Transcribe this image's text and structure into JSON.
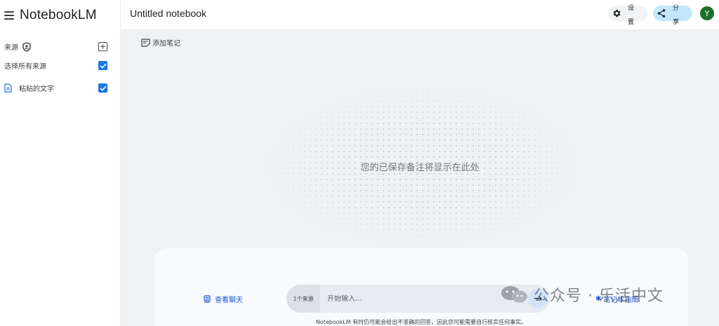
{
  "app": {
    "title": "NotebookLM"
  },
  "sidebar": {
    "sources_label": "来源",
    "select_all_label": "选择所有来源",
    "items": [
      {
        "label": "粘贴的文字"
      }
    ]
  },
  "header": {
    "notebook_title": "Untitled notebook",
    "settings_label": "设置",
    "share_label": "分享",
    "avatar_letter": "Y"
  },
  "main": {
    "add_note_label": "添加笔记",
    "empty_state": "您的已保存备注将显示在此处"
  },
  "chat": {
    "view_chat_label": "查看聊天",
    "source_count": "1个来源",
    "input_placeholder": "开始输入...",
    "notebook_guide_label": "笔记本指南",
    "disclaimer": "NotebookLM 有时仍可能会给出不准确的回答，因此您可能需要自行核实任何事实。"
  },
  "watermark": {
    "text": "公众号 · 乐活中文"
  },
  "colors": {
    "accent": "#1a73e8",
    "link": "#1a56db",
    "share_bg": "#c2e7ff",
    "avatar_bg": "#1e6f2a",
    "main_bg": "#f0f1f4"
  }
}
